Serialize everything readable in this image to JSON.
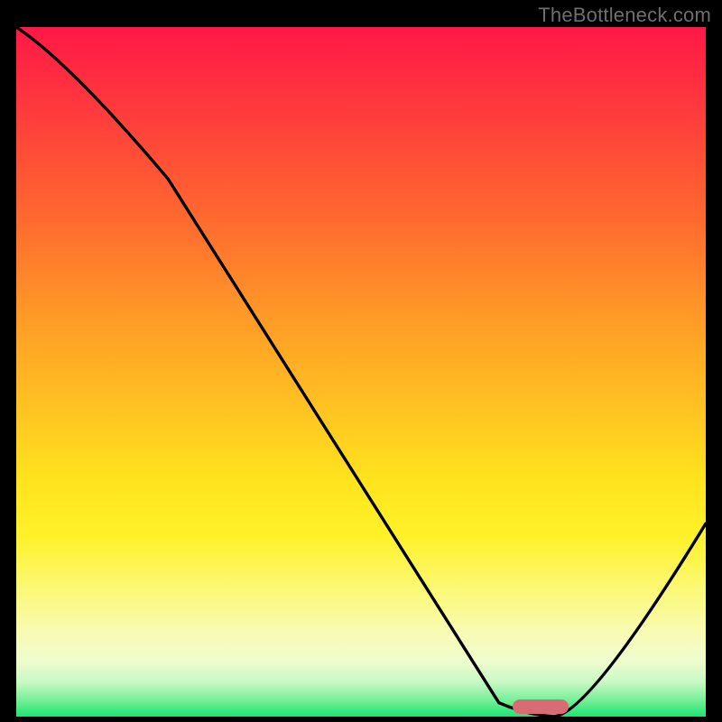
{
  "watermark": "TheBottleneck.com",
  "chart_data": {
    "type": "line",
    "title": "",
    "xlabel": "",
    "ylabel": "",
    "xlim": [
      0,
      100
    ],
    "ylim": [
      0,
      100
    ],
    "grid": false,
    "background_gradient": {
      "direction": "vertical",
      "stops": [
        {
          "pos": 0,
          "color": "#ff1846"
        },
        {
          "pos": 42,
          "color": "#ff9a27"
        },
        {
          "pos": 66,
          "color": "#ffe41e"
        },
        {
          "pos": 88,
          "color": "#f9fbb6"
        },
        {
          "pos": 100,
          "color": "#1be471"
        }
      ]
    },
    "series": [
      {
        "name": "bottleneck-curve",
        "x": [
          0,
          22,
          70,
          78,
          100
        ],
        "y": [
          100,
          78,
          2,
          0,
          28
        ]
      }
    ],
    "marker": {
      "name": "optimal-range",
      "x": 76,
      "y": 1.4,
      "color": "#d96b74"
    }
  }
}
